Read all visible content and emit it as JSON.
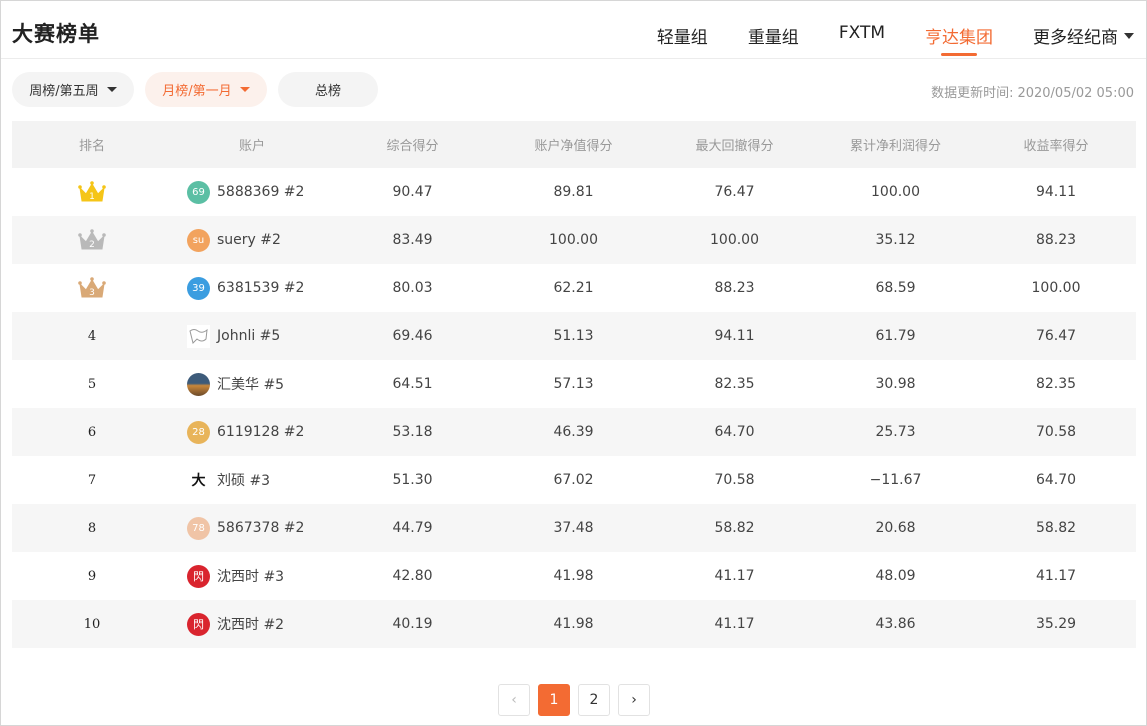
{
  "title": "大赛榜单",
  "tabs": [
    {
      "label": "轻量组",
      "active": false
    },
    {
      "label": "重量组",
      "active": false
    },
    {
      "label": "FXTM",
      "active": false
    },
    {
      "label": "亨达集团",
      "active": true
    },
    {
      "label": "更多经纪商",
      "active": false,
      "dropdown": true
    }
  ],
  "filters": {
    "weekly": "周榜/第五周",
    "monthly": "月榜/第一月",
    "overall": "总榜"
  },
  "update": {
    "label": "数据更新时间:",
    "value": "2020/05/02 05:00"
  },
  "table": {
    "headers": [
      "排名",
      "账户",
      "综合得分",
      "账户净值得分",
      "最大回撤得分",
      "累计净利润得分",
      "收益率得分"
    ],
    "rows": [
      {
        "rank": "1",
        "avatar": "69",
        "avatar_color": "#5bbfa4",
        "account": "5888369 #2",
        "total": "90.47",
        "equity": "89.81",
        "drawdown": "76.47",
        "profit": "100.00",
        "return_rate": "94.11"
      },
      {
        "rank": "2",
        "avatar": "su",
        "avatar_color": "#f2a35e",
        "account": "suery #2",
        "total": "83.49",
        "equity": "100.00",
        "drawdown": "100.00",
        "profit": "35.12",
        "return_rate": "88.23"
      },
      {
        "rank": "3",
        "avatar": "39",
        "avatar_color": "#3b9de0",
        "account": "6381539 #2",
        "total": "80.03",
        "equity": "62.21",
        "drawdown": "88.23",
        "profit": "68.59",
        "return_rate": "100.00"
      },
      {
        "rank": "4",
        "avatar": "",
        "avatar_color": "#ffffff",
        "account": "Johnli #5",
        "total": "69.46",
        "equity": "51.13",
        "drawdown": "94.11",
        "profit": "61.79",
        "return_rate": "76.47"
      },
      {
        "rank": "5",
        "avatar": "",
        "avatar_color": "#3d5b7a",
        "account": "汇美华 #5",
        "total": "64.51",
        "equity": "57.13",
        "drawdown": "82.35",
        "profit": "30.98",
        "return_rate": "82.35"
      },
      {
        "rank": "6",
        "avatar": "28",
        "avatar_color": "#e8b45a",
        "account": "6119128 #2",
        "total": "53.18",
        "equity": "46.39",
        "drawdown": "64.70",
        "profit": "25.73",
        "return_rate": "70.58"
      },
      {
        "rank": "7",
        "avatar": "大",
        "avatar_color": "#ffffff",
        "account": "刘硕 #3",
        "total": "51.30",
        "equity": "67.02",
        "drawdown": "70.58",
        "profit": "−11.67",
        "return_rate": "64.70"
      },
      {
        "rank": "8",
        "avatar": "78",
        "avatar_color": "#f0c4a6",
        "account": "5867378 #2",
        "total": "44.79",
        "equity": "37.48",
        "drawdown": "58.82",
        "profit": "20.68",
        "return_rate": "58.82"
      },
      {
        "rank": "9",
        "avatar": "閃",
        "avatar_color": "#d9242e",
        "account": "沈西时 #3",
        "total": "42.80",
        "equity": "41.98",
        "drawdown": "41.17",
        "profit": "48.09",
        "return_rate": "41.17"
      },
      {
        "rank": "10",
        "avatar": "閃",
        "avatar_color": "#d9242e",
        "account": "沈西时 #2",
        "total": "40.19",
        "equity": "41.98",
        "drawdown": "41.17",
        "profit": "43.86",
        "return_rate": "35.29"
      }
    ]
  },
  "pagination": {
    "prev": "‹",
    "pages": [
      "1",
      "2"
    ],
    "current": "1",
    "next": "›"
  },
  "colors": {
    "accent": "#f36b33",
    "gold": "#f5c518",
    "silver": "#b9b9b9",
    "bronze": "#d9a977"
  }
}
